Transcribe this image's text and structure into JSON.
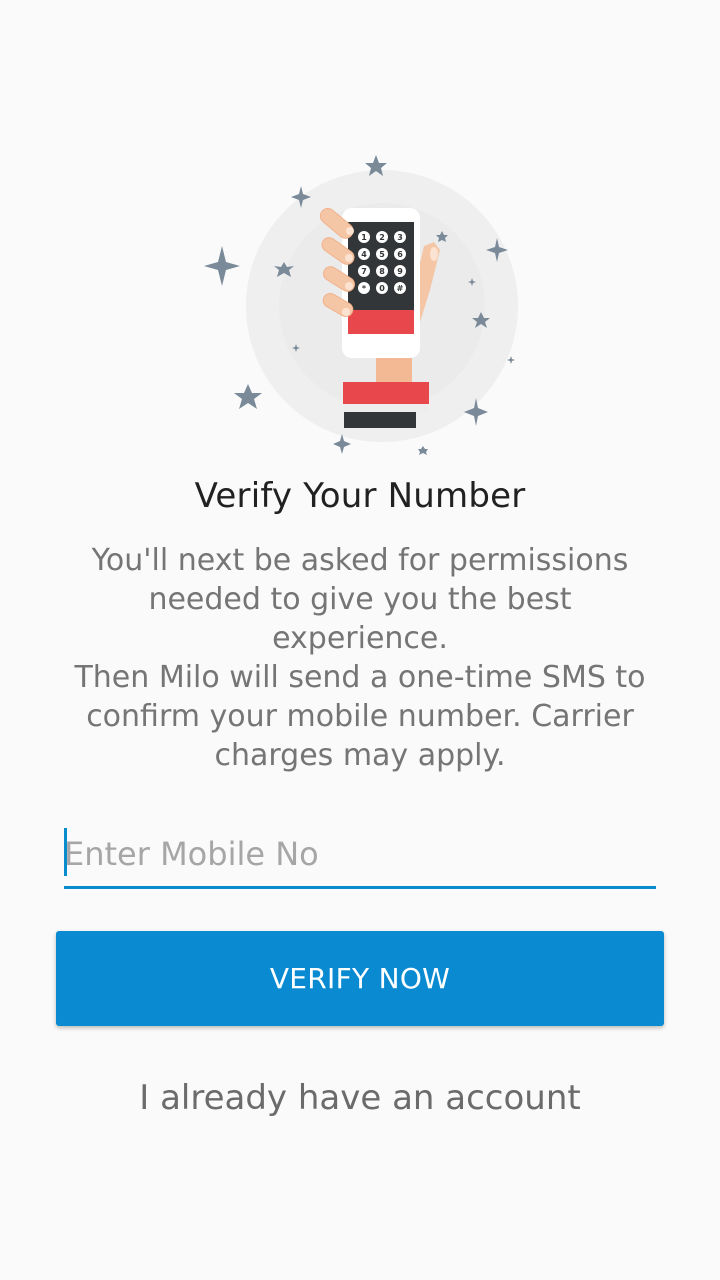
{
  "colors": {
    "background": "#fafafa",
    "accent": "#0a8bd1",
    "title": "#212121",
    "body_text": "#757575",
    "star": "#7a8a99",
    "phone_red": "#e8474b"
  },
  "illustration": {
    "icon": "hand-holding-phone-icon",
    "keypad_keys": [
      "1",
      "2",
      "3",
      "4",
      "5",
      "6",
      "7",
      "8",
      "9",
      "*",
      "0",
      "#"
    ]
  },
  "title": "Verify Your Number",
  "description": {
    "paragraph1": [
      "You'll next be asked for permissions",
      "needed to give you the best experience."
    ],
    "paragraph2": [
      "Then Milo will send a one-time SMS to",
      "confirm your mobile number. Carrier",
      "charges may apply."
    ]
  },
  "mobile_input": {
    "placeholder": "Enter Mobile No",
    "value": ""
  },
  "verify_button": {
    "label": "VERIFY NOW"
  },
  "account_link": {
    "label": "I already have an account"
  }
}
